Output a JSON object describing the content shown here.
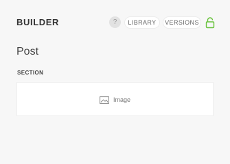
{
  "header": {
    "title": "BUILDER",
    "help_label": "?",
    "library_label": "LIBRARY",
    "versions_label": "VERSIONS",
    "lock_icon": "unlock-icon",
    "accent_color": "#67c23a"
  },
  "main": {
    "post_title": "Post",
    "section_label": "SECTION",
    "placeholder_label": "Image",
    "placeholder_icon": "image-icon"
  }
}
